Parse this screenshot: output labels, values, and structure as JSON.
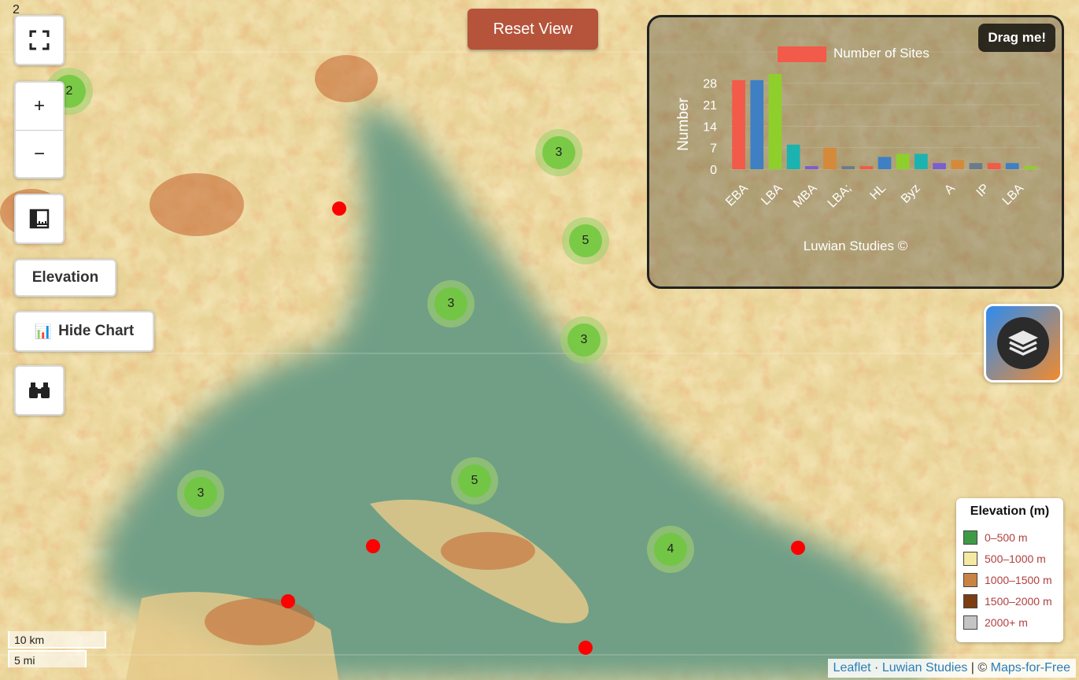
{
  "top_left_label": "2",
  "reset_button": "Reset View",
  "controls": {
    "zoom_in": "+",
    "zoom_out": "−",
    "elevation_button": "Elevation",
    "hide_chart_button": "Hide Chart",
    "hide_chart_icon": "📊"
  },
  "map": {
    "clusters": [
      {
        "count": "2"
      },
      {
        "count": "3"
      },
      {
        "count": "5"
      },
      {
        "count": "3"
      },
      {
        "count": "3"
      },
      {
        "count": "5"
      },
      {
        "count": "3"
      },
      {
        "count": "4"
      }
    ],
    "points": 6
  },
  "chart_panel": {
    "drag_label": "Drag me!",
    "credit": "Luwian Studies ©"
  },
  "chart_data": {
    "type": "bar",
    "title": "",
    "legend": "Number of Sites",
    "ylabel": "Number",
    "xlabel": "",
    "ylim": [
      0,
      31
    ],
    "yticks": [
      0,
      7,
      14,
      21,
      28
    ],
    "xtick_labels": [
      "EBA",
      "LBA",
      "MBA",
      "LBA;",
      "HL",
      "Byz",
      "A",
      "IP",
      "LBA"
    ],
    "values": [
      29,
      29,
      31,
      8,
      1,
      7,
      1,
      1,
      4,
      5,
      5,
      2,
      3,
      2,
      2,
      2,
      1
    ],
    "colors": [
      "#f25a4a",
      "#3f7fc4",
      "#8ecf2c",
      "#1bb3b0",
      "#7a5fd0",
      "#d48a3a",
      "#6c7a8c",
      "#f25a4a",
      "#3f7fc4",
      "#8ecf2c",
      "#1bb3b0",
      "#7a5fd0",
      "#d48a3a",
      "#6c7a8c",
      "#f25a4a",
      "#3f7fc4",
      "#8ecf2c"
    ]
  },
  "elevation_legend": {
    "title": "Elevation (m)",
    "items": [
      {
        "label": "0–500 m",
        "color": "#3e9a46"
      },
      {
        "label": "500–1000 m",
        "color": "#f4e9a0"
      },
      {
        "label": "1000–1500 m",
        "color": "#c98443"
      },
      {
        "label": "1500–2000 m",
        "color": "#7a3e12"
      },
      {
        "label": "2000+ m",
        "color": "#c4c4c4"
      }
    ]
  },
  "scale": {
    "metric": "10 km",
    "imperial": "5 mi"
  },
  "attribution": {
    "leaflet": "Leaflet",
    "sep1": "·",
    "luwian": "Luwian Studies",
    "sep2": "| ©",
    "tiles": "Maps-for-Free"
  }
}
